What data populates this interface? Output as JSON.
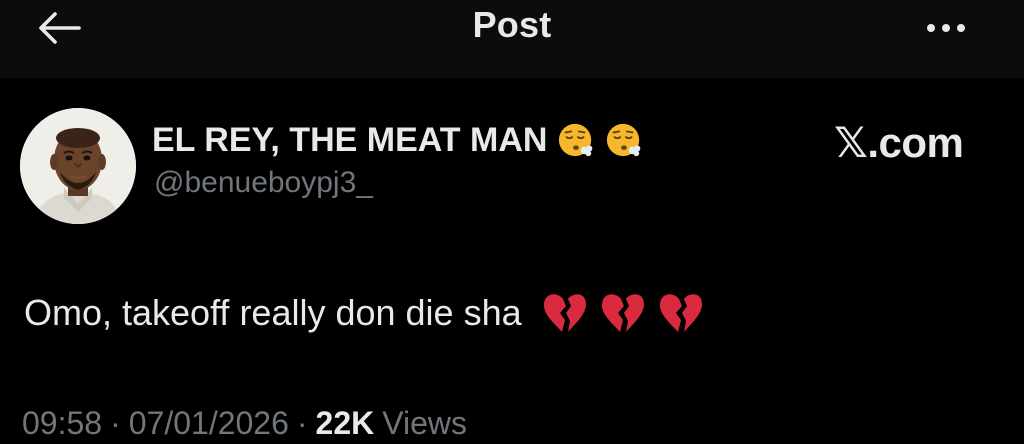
{
  "header": {
    "title": "Post",
    "back_icon": "arrow-left-icon",
    "more_icon": "more-horizontal-icon"
  },
  "author": {
    "display_name": "EL REY, THE MEAT MAN",
    "name_emojis": [
      "face-exhaling-emoji",
      "face-exhaling-emoji"
    ],
    "handle": "@benueboypj3_",
    "avatar_icon": "avatar"
  },
  "source": {
    "label": "𝕏.com"
  },
  "post": {
    "text": "Omo, takeoff really don die sha",
    "emojis": [
      "broken-heart-emoji",
      "broken-heart-emoji",
      "broken-heart-emoji"
    ]
  },
  "meta": {
    "time": "09:58",
    "date": "07/01/2026",
    "views_count": "22K",
    "views_label": "Views",
    "separator": "·"
  },
  "colors": {
    "background": "#000000",
    "header_background": "#0c0c0c",
    "primary_text": "#e7e9ea",
    "secondary_text": "#71767b",
    "heart_red": "#d92a3f",
    "emoji_yellow": "#f5b82a"
  }
}
